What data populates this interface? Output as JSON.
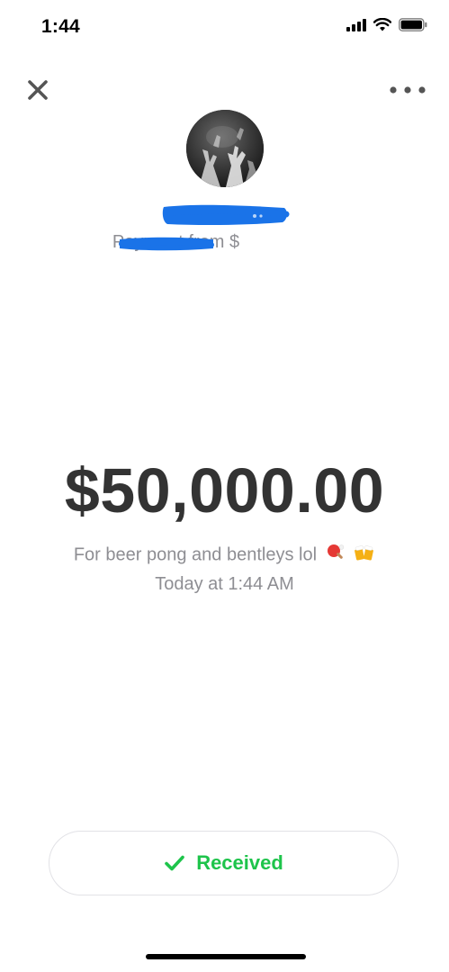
{
  "status_bar": {
    "time": "1:44",
    "signal_icon": "cellular-signal-icon",
    "wifi_icon": "wifi-icon",
    "battery_icon": "battery-icon"
  },
  "header": {
    "close_icon": "close-icon",
    "more_icon": "more-horizontal-icon"
  },
  "sender": {
    "avatar": "avatar-photo",
    "prefix": "Payment from $"
  },
  "payment": {
    "amount": "$50,000.00",
    "note": "For beer pong and bentleys lol",
    "note_emojis": [
      "ping-pong-icon",
      "beer-mugs-icon"
    ],
    "timestamp": "Today at 1:44 AM"
  },
  "status": {
    "label": "Received",
    "icon": "checkmark-icon",
    "color": "#1ec44b"
  },
  "colors": {
    "amount_text": "#333333",
    "secondary_text": "#8e8e93",
    "redaction": "#1a73e8"
  }
}
